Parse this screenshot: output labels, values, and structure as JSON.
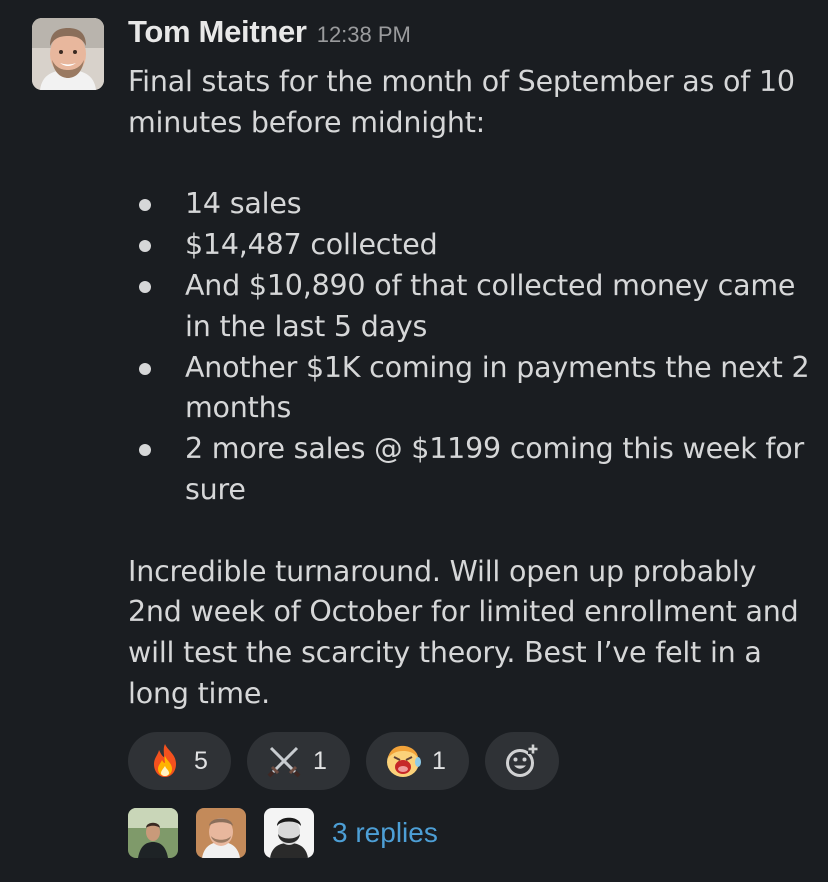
{
  "message": {
    "author": "Tom Meitner",
    "timestamp": "12:38 PM",
    "intro": "Final stats for the month of September as of 10 minutes before midnight:",
    "bullets": [
      "14 sales",
      "$14,487 collected",
      "And $10,890 of that collected money came in the last 5 days",
      "Another $1K coming in payments the next 2 months",
      "2 more sales @ $1199 coming this week for sure"
    ],
    "closing": "Incredible turnaround. Will open up probably 2nd week of October for limited enrollment and will test the scarcity theory. Best I’ve felt in a long time."
  },
  "reactions": [
    {
      "icon": "fire-icon",
      "count": "5"
    },
    {
      "icon": "crossed-swords-icon",
      "count": "1"
    },
    {
      "icon": "screaming-face-icon",
      "count": "1"
    }
  ],
  "add_reaction_icon": "add-emoji-icon",
  "thread": {
    "replies_label": "3 replies",
    "avatars": [
      "reply-avatar-1",
      "reply-avatar-2",
      "reply-avatar-3"
    ]
  },
  "colors": {
    "background": "#1a1d21",
    "link": "#4d9fd6",
    "reaction_pill": "#2f3236"
  }
}
